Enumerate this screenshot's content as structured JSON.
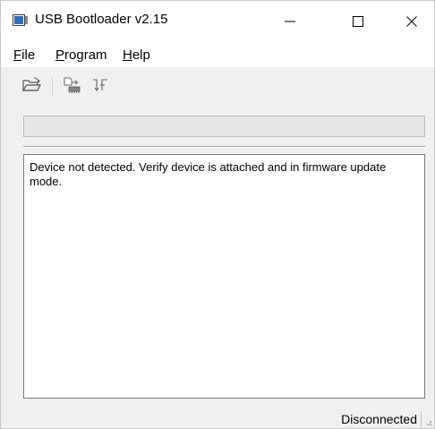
{
  "window": {
    "title": "USB Bootloader v2.15",
    "minimize_glyph": "—",
    "close_glyph": "✕"
  },
  "menu": {
    "file": {
      "underline": "F",
      "rest": "ile"
    },
    "program": {
      "underline": "P",
      "rest": "rogram"
    },
    "help": {
      "underline": "H",
      "rest": "elp"
    }
  },
  "toolbar": {
    "icons": [
      "open-folder-icon",
      "program-device-icon",
      "reset-device-icon"
    ]
  },
  "progress": {
    "value": 0
  },
  "log": {
    "text": "Device not detected.  Verify device is attached and in firmware update mode."
  },
  "status": {
    "text": "Disconnected"
  }
}
